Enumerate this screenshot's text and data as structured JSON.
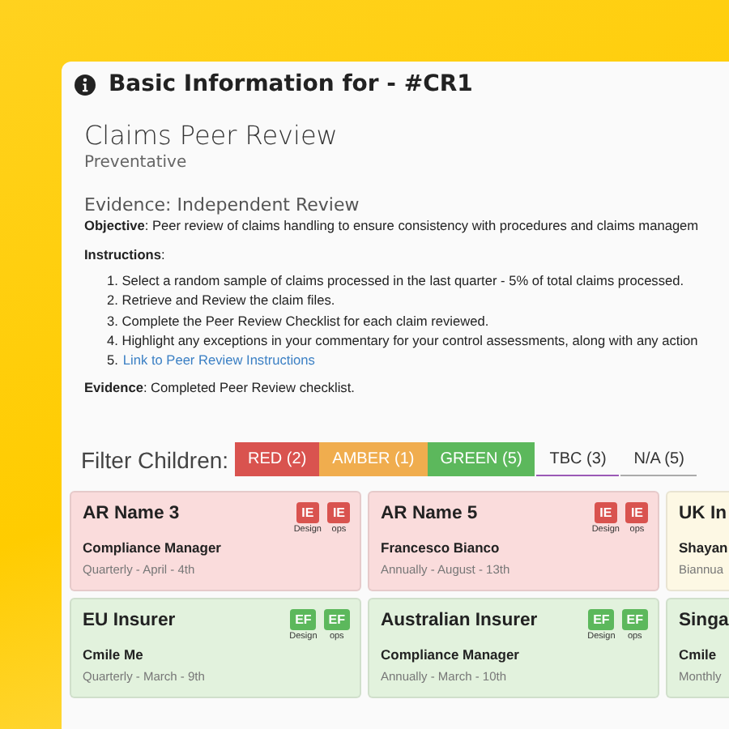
{
  "panel": {
    "title": "Basic Information for - #CR1"
  },
  "control": {
    "name": "Claims Peer Review",
    "type": "Preventative",
    "evidence_heading": "Evidence: Independent Review",
    "objective": "**Objective**: Peer review of claims handling to ensure consistency with procedures and claims managem",
    "instructions_label": "**Instructions**:",
    "instructions": [
      {
        "kind": "text",
        "text": "1. Select a random sample of claims processed in the last quarter - 5% of total claims processed."
      },
      {
        "kind": "text",
        "text": "2. Retrieve and Review the claim files."
      },
      {
        "kind": "text",
        "text": "3. Complete the Peer Review Checklist for each claim reviewed."
      },
      {
        "kind": "text",
        "text": "4. Highlight any exceptions in your commentary for your control assessments, along with any action"
      },
      {
        "kind": "link",
        "number": "5.",
        "text": "Link to Peer Review Instructions"
      }
    ],
    "evidence": "**Evidence**: Completed Peer Review checklist."
  },
  "filter": {
    "label": "Filter Children:",
    "options": [
      {
        "label": "RED (2)",
        "kind": "filled",
        "color": "#d9534f"
      },
      {
        "label": "AMBER (1)",
        "kind": "filled",
        "color": "#f0ad4e"
      },
      {
        "label": "GREEN (5)",
        "kind": "filled",
        "color": "#5cb85c"
      },
      {
        "label": "TBC (3)",
        "kind": "underlined",
        "color": "#9b59b6"
      },
      {
        "label": "N/A (5)",
        "kind": "underlined",
        "color": "#aaaaaa"
      }
    ]
  },
  "cards": [
    {
      "color": "#fadcdc",
      "name": "AR Name 3",
      "owner": "Compliance Manager",
      "schedule": "Quarterly - April - 4th",
      "badges": [
        {
          "code": "IE",
          "caption": "Design",
          "color": "#d9534f"
        },
        {
          "code": "IE",
          "caption": "ops",
          "color": "#d9534f"
        }
      ]
    },
    {
      "color": "#fadcdc",
      "name": "AR Name 5",
      "owner": "Francesco Bianco",
      "schedule": "Annually - August - 13th",
      "badges": [
        {
          "code": "IE",
          "caption": "Design",
          "color": "#d9534f"
        },
        {
          "code": "IE",
          "caption": "ops",
          "color": "#d9534f"
        }
      ]
    },
    {
      "color": "#fdf8e4",
      "name": "UK In",
      "owner": "Shayan",
      "schedule": "Biannua"
    },
    {
      "color": "#e2f2dd",
      "name": "EU Insurer",
      "owner": "Cmile Me",
      "schedule": "Quarterly - March - 9th",
      "badges": [
        {
          "code": "EF",
          "caption": "Design",
          "color": "#5cb85c"
        },
        {
          "code": "EF",
          "caption": "ops",
          "color": "#5cb85c"
        }
      ]
    },
    {
      "color": "#e2f2dd",
      "name": "Australian Insurer",
      "owner": "Compliance Manager",
      "schedule": "Annually - March - 10th",
      "badges": [
        {
          "code": "EF",
          "caption": "Design",
          "color": "#5cb85c"
        },
        {
          "code": "EF",
          "caption": "ops",
          "color": "#5cb85c"
        }
      ]
    },
    {
      "color": "#e2f2dd",
      "name": "Singa",
      "owner": "Cmile",
      "schedule": "Monthly"
    }
  ]
}
